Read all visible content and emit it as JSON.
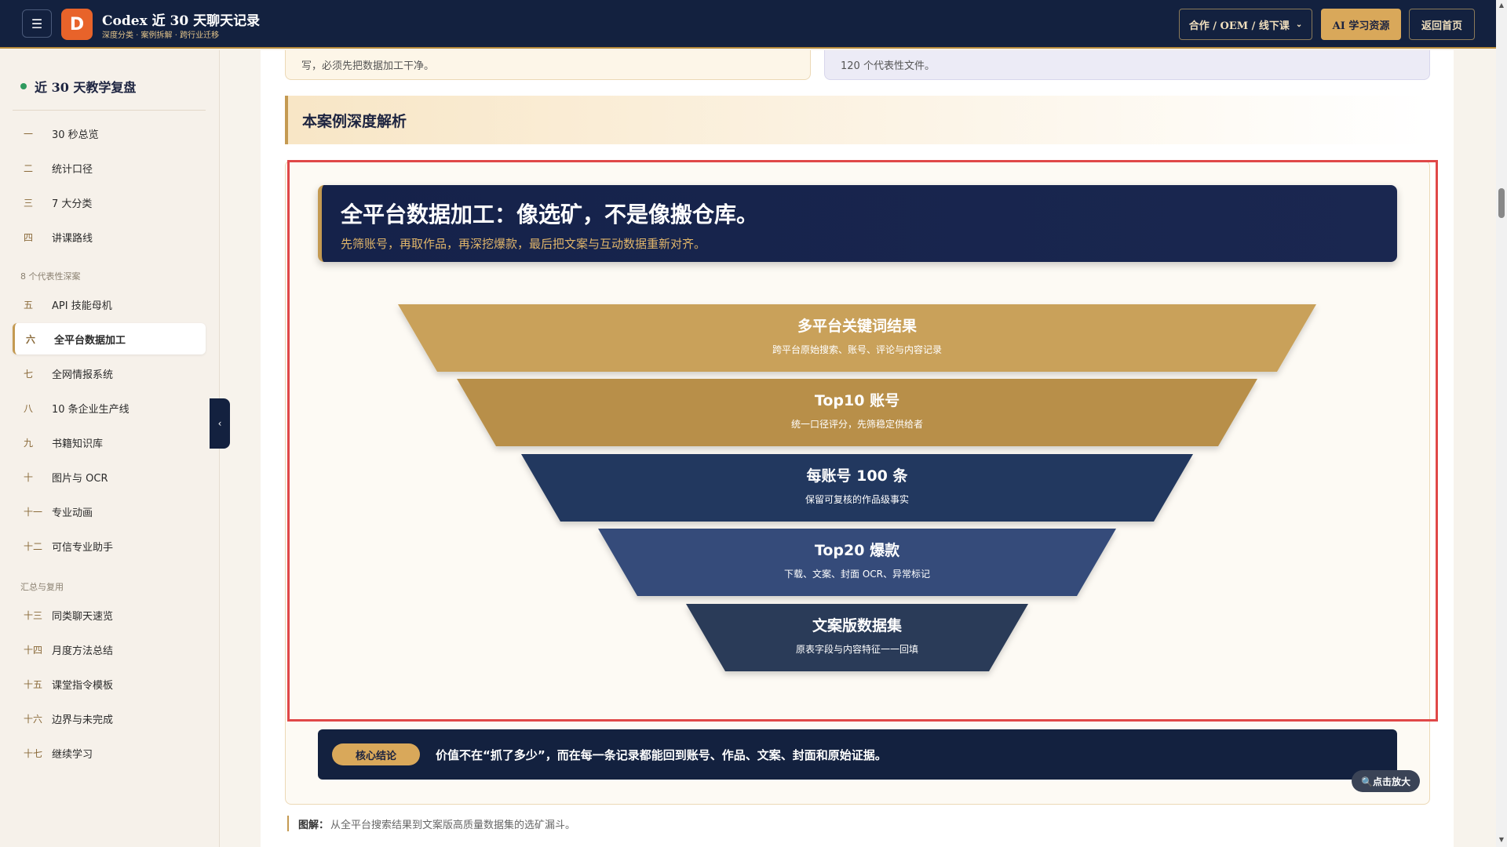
{
  "header": {
    "brand_title": "Codex 近 30 天聊天记录",
    "brand_sub": "深度分类 · 案例拆解 · 跨行业迁移",
    "logo_letter": "D",
    "btn_coop": "合作 / OEM / 线下课",
    "btn_ai": "AI 学习资源",
    "btn_home": "返回首页"
  },
  "sidebar": {
    "title": "近 30 天教学复盘",
    "items_top": [
      {
        "num": "一",
        "label": "30 秒总览"
      },
      {
        "num": "二",
        "label": "统计口径"
      },
      {
        "num": "三",
        "label": "7 大分类"
      },
      {
        "num": "四",
        "label": "讲课路线"
      }
    ],
    "group_cases": "8 个代表性深案",
    "items_cases": [
      {
        "num": "五",
        "label": "API 技能母机"
      },
      {
        "num": "六",
        "label": "全平台数据加工"
      },
      {
        "num": "七",
        "label": "全网情报系统"
      },
      {
        "num": "八",
        "label": "10 条企业生产线"
      },
      {
        "num": "九",
        "label": "书籍知识库"
      },
      {
        "num": "十",
        "label": "图片与 OCR"
      },
      {
        "num": "十一",
        "label": "专业动画"
      },
      {
        "num": "十二",
        "label": "可信专业助手"
      }
    ],
    "group_summary": "汇总与复用",
    "items_summary": [
      {
        "num": "十三",
        "label": "同类聊天速览"
      },
      {
        "num": "十四",
        "label": "月度方法总结"
      },
      {
        "num": "十五",
        "label": "课堂指令模板"
      },
      {
        "num": "十六",
        "label": "边界与未完成"
      },
      {
        "num": "十七",
        "label": "继续学习"
      }
    ]
  },
  "main": {
    "top_left_text": "写，必须先把数据加工干净。",
    "top_right_text": "120 个代表性文件。",
    "section_title": "本案例深度解析",
    "banner_title": "全平台数据加工：像选矿，不是像搬仓库。",
    "banner_sub": "先筛账号，再取作品，再深挖爆款，最后把文案与互动数据重新对齐。",
    "funnel": [
      {
        "title": "多平台关键词结果",
        "sub": "跨平台原始搜索、账号、评论与内容记录",
        "color": "#c9a15a"
      },
      {
        "title": "Top10 账号",
        "sub": "统一口径评分，先筛稳定供给者",
        "color": "#b88f4a"
      },
      {
        "title": "每账号 100 条",
        "sub": "保留可复核的作品级事实",
        "color": "#24375f"
      },
      {
        "title": "Top20 爆款",
        "sub": "下载、文案、封面 OCR、异常标记",
        "color": "#344b7a"
      },
      {
        "title": "文案版数据集",
        "sub": "原表字段与内容特征一一回填",
        "color": "#2c3a58"
      }
    ],
    "conclusion_pill": "核心结论",
    "conclusion_text": "价值不在“抓了多少”，而在每一条记录都能回到账号、作品、文案、封面和原始证据。",
    "zoom_label": "🔍点击放大",
    "caption_label": "图解：",
    "caption_text": "从全平台搜索结果到文案版高质量数据集的选矿漏斗。"
  }
}
